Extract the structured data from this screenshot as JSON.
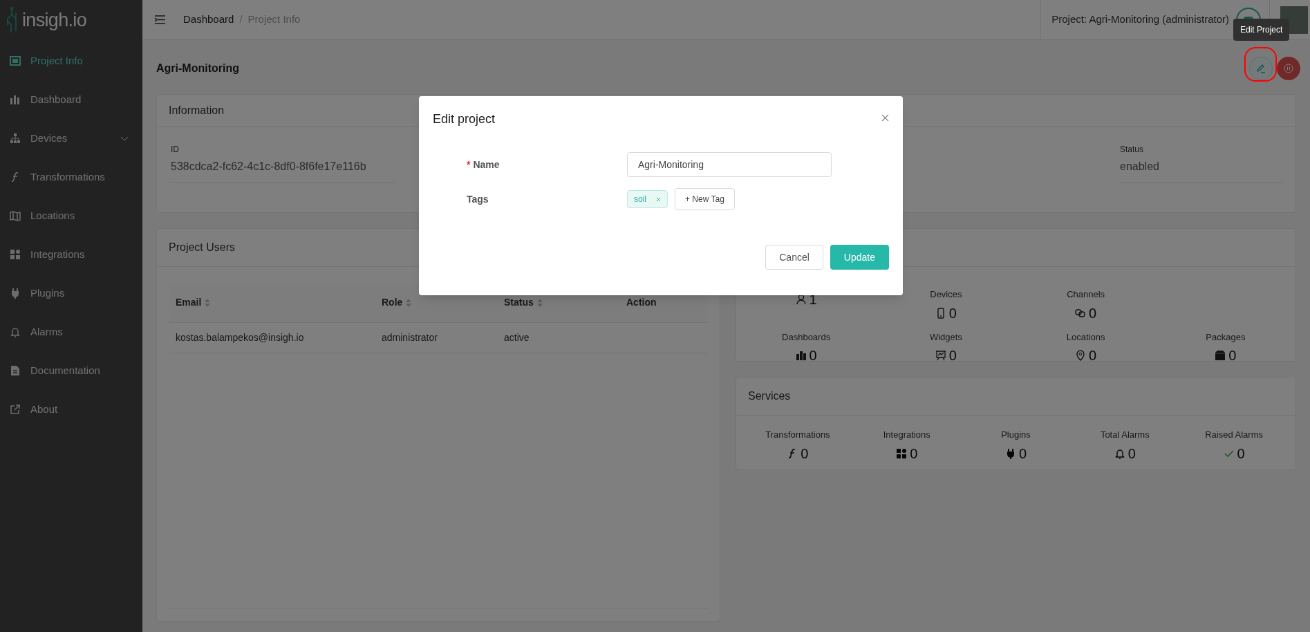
{
  "sidebar": {
    "logo": {
      "name": "insigh",
      "suffix": ".io"
    },
    "items": [
      {
        "label": "Project Info",
        "selected": true,
        "has_submenu": false
      },
      {
        "label": "Dashboard",
        "selected": false,
        "has_submenu": false
      },
      {
        "label": "Devices",
        "selected": false,
        "has_submenu": true
      },
      {
        "label": "Transformations",
        "selected": false,
        "has_submenu": false
      },
      {
        "label": "Locations",
        "selected": false,
        "has_submenu": false
      },
      {
        "label": "Integrations",
        "selected": false,
        "has_submenu": false
      },
      {
        "label": "Plugins",
        "selected": false,
        "has_submenu": false
      },
      {
        "label": "Alarms",
        "selected": false,
        "has_submenu": false
      },
      {
        "label": "Documentation",
        "selected": false,
        "has_submenu": false
      },
      {
        "label": "About",
        "selected": false,
        "has_submenu": false
      }
    ]
  },
  "header": {
    "separator": "/",
    "breadcrumb": [
      {
        "label": "Dashboard",
        "selected": false
      },
      {
        "label": "Project Info",
        "selected": true
      }
    ],
    "project": "Project: Agri-Monitoring (administrator)"
  },
  "page_title": "Agri-Monitoring",
  "tooltip": "Edit Project",
  "information": {
    "title": "Information",
    "fields": [
      {
        "label": "ID",
        "value": "538cdca2-fc62-4c1c-8df0-8f6fe17e116b"
      },
      {
        "label": "Status",
        "value": "enabled"
      }
    ]
  },
  "project_users": {
    "title": "Project Users",
    "columns": [
      {
        "label": "Email",
        "sortable": true
      },
      {
        "label": "Role",
        "sortable": true
      },
      {
        "label": "Status",
        "sortable": true
      },
      {
        "label": "Action",
        "sortable": false
      }
    ],
    "rows": [
      [
        "kostas.balampekos@insigh.io",
        "administrator",
        "active"
      ]
    ]
  },
  "statistics": {
    "rows": [
      [
        {
          "value": "1"
        },
        {
          "label": "Devices",
          "value": "0"
        },
        {
          "label": "Channels",
          "value": "0"
        }
      ],
      [
        {
          "label": "Dashboards",
          "value": "0"
        },
        {
          "label": "Widgets",
          "value": "0"
        },
        {
          "label": "Locations",
          "value": "0"
        },
        {
          "label": "Packages",
          "value": "0"
        }
      ]
    ]
  },
  "services": {
    "title": "Services",
    "items": [
      {
        "label": "Transformations",
        "value": "0"
      },
      {
        "label": "Integrations",
        "value": "0"
      },
      {
        "label": "Plugins",
        "value": "0"
      },
      {
        "label": "Total Alarms",
        "value": "0"
      },
      {
        "label": "Raised Alarms",
        "value": "0"
      }
    ]
  },
  "modal": {
    "title": "Edit project",
    "name_label": "Name",
    "required_mark": "*",
    "name_value": "Agri-Monitoring",
    "tags_label": "Tags",
    "tags": [
      "soil"
    ],
    "new_tag": "+ New Tag",
    "cancel": "Cancel",
    "update": "Update"
  }
}
